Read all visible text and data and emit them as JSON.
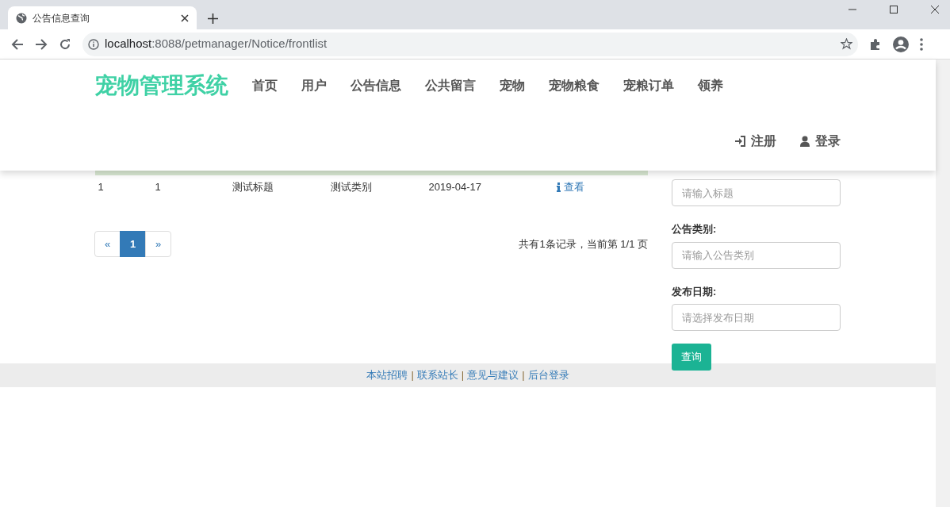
{
  "browser": {
    "tab_title": "公告信息查询",
    "url_host": "localhost",
    "url_path": ":8088/petmanager/Notice/frontlist"
  },
  "navbar": {
    "brand": "宠物管理系统",
    "items": [
      {
        "label": "首页"
      },
      {
        "label": "用户"
      },
      {
        "label": "公告信息"
      },
      {
        "label": "公共留言"
      },
      {
        "label": "宠物"
      },
      {
        "label": "宠物粮食"
      },
      {
        "label": "宠粮订单"
      },
      {
        "label": "领养"
      }
    ],
    "auth": [
      {
        "kind": "register",
        "label": "注册"
      },
      {
        "kind": "login",
        "label": "登录"
      }
    ]
  },
  "table": {
    "rows": [
      {
        "cells": [
          "1",
          "1",
          "测试标题",
          "测试类别",
          "2019-04-17"
        ],
        "action": "查看"
      }
    ]
  },
  "pagination": {
    "prev": "«",
    "pages": [
      {
        "label": "1",
        "selected": true
      }
    ],
    "next": "»",
    "summary": "共有1条记录，当前第 1/1 页"
  },
  "search": {
    "fields": [
      {
        "placeholder": "请输入标题"
      },
      {
        "label": "公告类别:",
        "placeholder": "请输入公告类别"
      },
      {
        "label": "发布日期:",
        "placeholder": "请选择发布日期"
      }
    ],
    "button": "查询"
  },
  "footer": {
    "links": [
      "本站招聘",
      "联系站长",
      "意见与建议",
      "后台登录"
    ],
    "separators": [
      "|",
      "|",
      "|"
    ]
  }
}
